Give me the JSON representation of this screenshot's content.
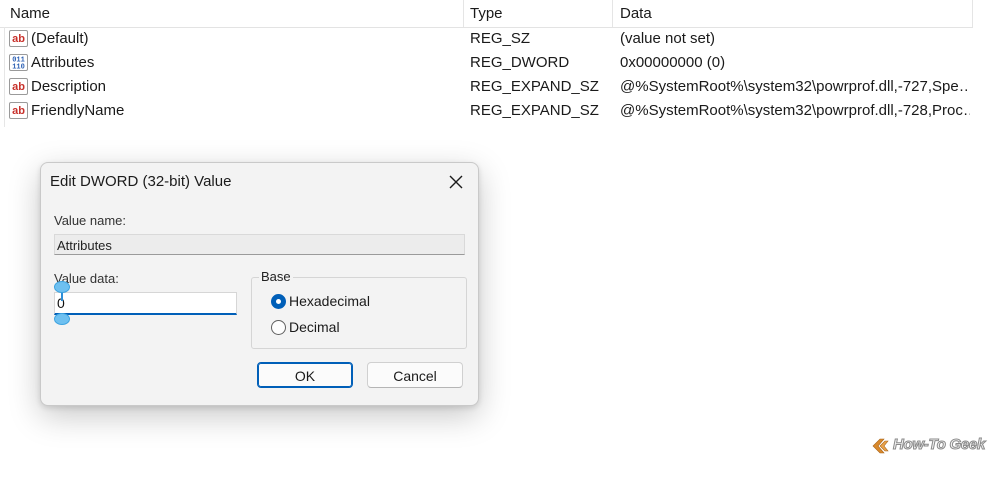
{
  "registry": {
    "columns": {
      "name": "Name",
      "type": "Type",
      "data": "Data"
    },
    "rows": [
      {
        "name": "(Default)",
        "type": "REG_SZ",
        "data": "(value not set)",
        "icon": "string-value-icon"
      },
      {
        "name": "Attributes",
        "type": "REG_DWORD",
        "data": "0x00000000 (0)",
        "icon": "binary-value-icon"
      },
      {
        "name": "Description",
        "type": "REG_EXPAND_SZ",
        "data": "@%SystemRoot%\\system32\\powrprof.dll,-727,Spe…",
        "icon": "string-value-icon"
      },
      {
        "name": "FriendlyName",
        "type": "REG_EXPAND_SZ",
        "data": "@%SystemRoot%\\system32\\powrprof.dll,-728,Proc…",
        "icon": "string-value-icon"
      }
    ],
    "icon_labels": {
      "string": "ab",
      "binary_top": "011",
      "binary_bottom": "110"
    }
  },
  "dialog": {
    "title": "Edit DWORD (32-bit) Value",
    "value_name_label": "Value name:",
    "value_name": "Attributes",
    "value_data_label": "Value data:",
    "value_data": "0",
    "base_label": "Base",
    "base_options": [
      {
        "label": "Hexadecimal",
        "selected": true
      },
      {
        "label": "Decimal",
        "selected": false
      }
    ],
    "ok_label": "OK",
    "cancel_label": "Cancel"
  },
  "watermark": {
    "text": "How-To Geek"
  },
  "colors": {
    "accent": "#005fb8",
    "icon_red": "#c8312b",
    "icon_blue": "#2b5fb3",
    "watermark_orange": "#d9892b"
  }
}
